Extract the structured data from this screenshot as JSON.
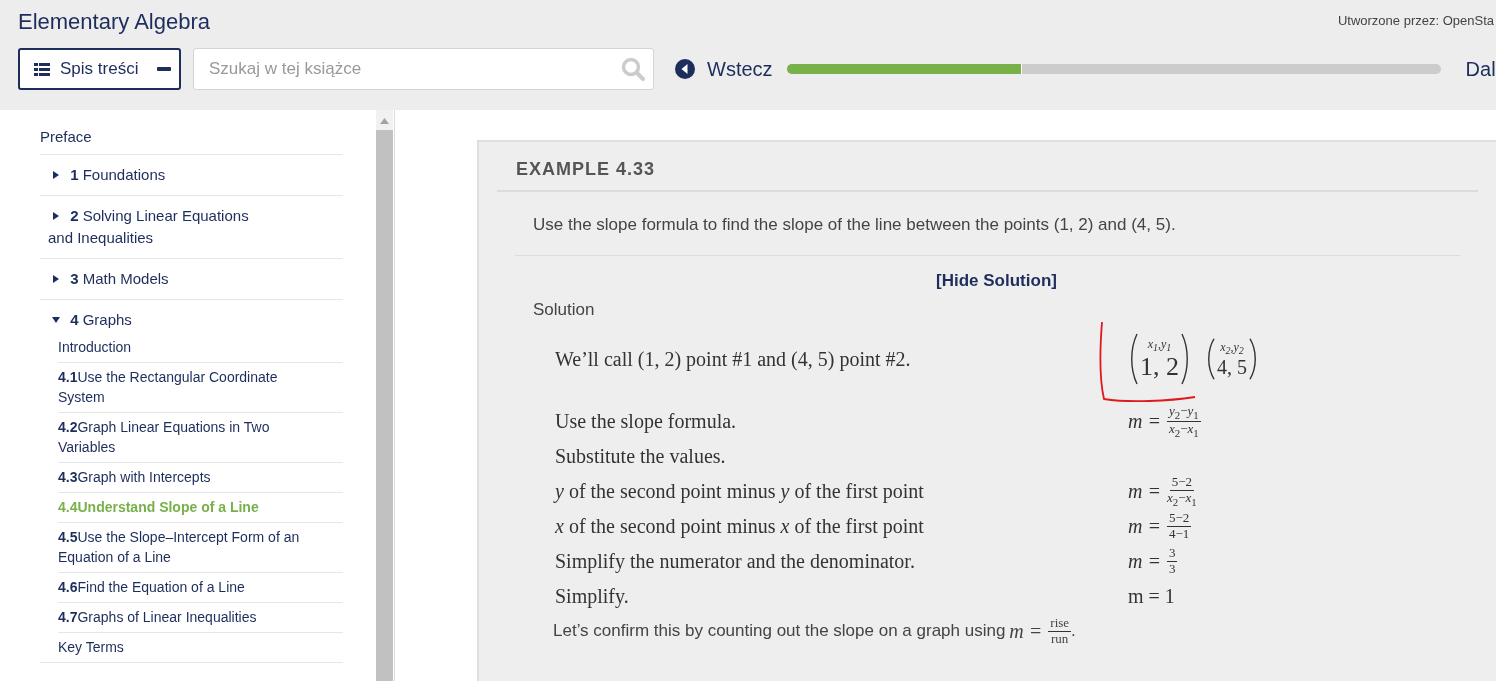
{
  "header": {
    "book_title": "Elementary Algebra",
    "credit": "Utworzone przez: OpenSta",
    "toc_button": {
      "label": "Spis treści",
      "expanded": true
    },
    "search": {
      "placeholder": "Szukaj w tej książce"
    },
    "back_link": "Wstecz",
    "progress": {
      "level": 0.36
    },
    "next_link": "Dal"
  },
  "sidebar": {
    "items": [
      {
        "title": "Preface"
      },
      {
        "number": "1",
        "title": "Foundations",
        "expanded": false
      },
      {
        "number": "2",
        "title": "Solving Linear Equations and Inequalities",
        "expanded": false
      },
      {
        "number": "3",
        "title": "Math Models",
        "expanded": false
      },
      {
        "number": "4",
        "title": "Graphs",
        "expanded": true,
        "children": [
          {
            "title": "Introduction",
            "selected": false
          },
          {
            "number": "4.1",
            "title": "Use the Rectangular Coordinate System",
            "selected": false
          },
          {
            "number": "4.2",
            "title": "Graph Linear Equations in Two Variables",
            "selected": false
          },
          {
            "number": "4.3",
            "title": "Graph with Intercepts",
            "selected": false
          },
          {
            "number": "4.4",
            "title": "Understand Slope of a Line",
            "selected": true
          },
          {
            "number": "4.5",
            "title": "Use the Slope–Intercept Form of an Equation of a Line",
            "selected": false
          },
          {
            "number": "4.6",
            "title": "Find the Equation of a Line",
            "selected": false
          },
          {
            "number": "4.7",
            "title": "Graphs of Linear Inequalities",
            "selected": false
          },
          {
            "title": "Key Terms",
            "selected": false
          }
        ]
      }
    ]
  },
  "example": {
    "title": "EXAMPLE 4.33",
    "problem": "Use the slope formula to find the slope of the line between the points (1, 2) and (4, 5).",
    "toggle": "[Hide Solution]",
    "solution_label": "Solution",
    "rows": [
      {
        "text": "We’ll call (1, 2) point #1 and (4, 5) point #2.",
        "math": {
          "kind": "points",
          "points": [
            {
              "label": "*x*$_{1}$,*y*$_{1}$",
              "value": "1, 2"
            },
            {
              "label": "*x*$_{2}$,*y*$_{2}$",
              "value": "4, 5"
            }
          ]
        }
      },
      {
        "text": "Use the slope formula.",
        "math": {
          "kind": "fraction",
          "lhs": "m =",
          "numerator": "*y*$_{2}$−*y*$_{1}$",
          "denominator": "*x*$_{2}$−*x*$_{1}$"
        }
      },
      {
        "text": "Substitute the values.",
        "math": {
          "kind": "none"
        }
      },
      {
        "text": "*y* of the second point minus *y* of the first point",
        "math": {
          "kind": "fraction",
          "lhs": "m =",
          "numerator": "5−2",
          "denominator": "*x*$_{2}$−*x*$_{1}$"
        }
      },
      {
        "text": "*x* of the second point minus *x* of the first point",
        "math": {
          "kind": "fraction",
          "lhs": "m =",
          "numerator": "5−2",
          "denominator": "4−1"
        }
      },
      {
        "text": "Simplify the numerator and the denominator.",
        "math": {
          "kind": "fraction",
          "lhs": "m =",
          "numerator": "3",
          "denominator": "3"
        }
      },
      {
        "text": "Simplify.",
        "math": {
          "kind": "plain",
          "expression": "m = 1"
        }
      }
    ],
    "closing": {
      "text": "Let’s confirm this by counting out the slope on a graph using",
      "lhs": "m =",
      "numerator": "rise",
      "denominator": "run",
      "end": "."
    }
  }
}
